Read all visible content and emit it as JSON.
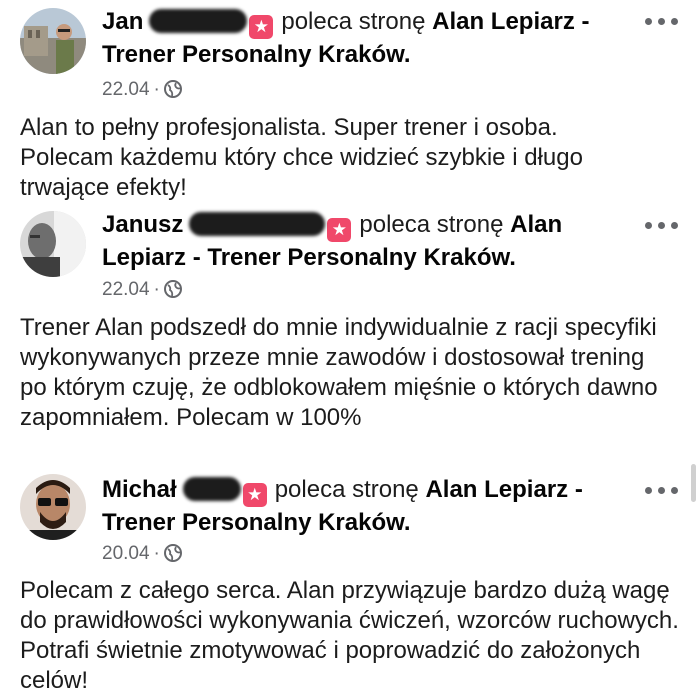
{
  "reviews": [
    {
      "name": "Jan",
      "verb": "poleca stronę",
      "page": "Alan Lepiarz - Trener Personalny Kraków.",
      "date": "22.04",
      "text": "Alan to pełny profesjonalista. Super trener i osoba. Polecam każdemu który chce widzieć szybkie i długo trwające efekty!"
    },
    {
      "name": "Janusz",
      "verb": "poleca stronę",
      "page_line1": "Alan",
      "page_line2": "Lepiarz - Trener Personalny Kraków.",
      "date": "22.04",
      "text": "Trener Alan podszedł do mnie indywidualnie z racji specyfiki wykonywanych przeze mnie zawodów i dostosował trening po którym czuję, że odblokowałem mięśnie o których dawno zapomniałem. Polecam w 100%"
    },
    {
      "name": "Michał",
      "verb": "poleca stronę",
      "page": "Alan Lepiarz - Trener Personalny Kraków.",
      "date": "20.04",
      "text": "Polecam z całego serca. Alan przywiązuje bardzo dużą wagę do prawidłowości wykonywania ćwiczeń, wzorców ruchowych. Potrafi świetnie zmotywować i poprowadzić do założonych celów!"
    }
  ],
  "dot": "·",
  "badge_glyph": "★",
  "icons": {
    "recommend": "star-badge-icon",
    "audience": "globe-icon",
    "menu": "more-options-icon"
  },
  "colors": {
    "badge": "#f0486a",
    "meta": "#65676b"
  }
}
